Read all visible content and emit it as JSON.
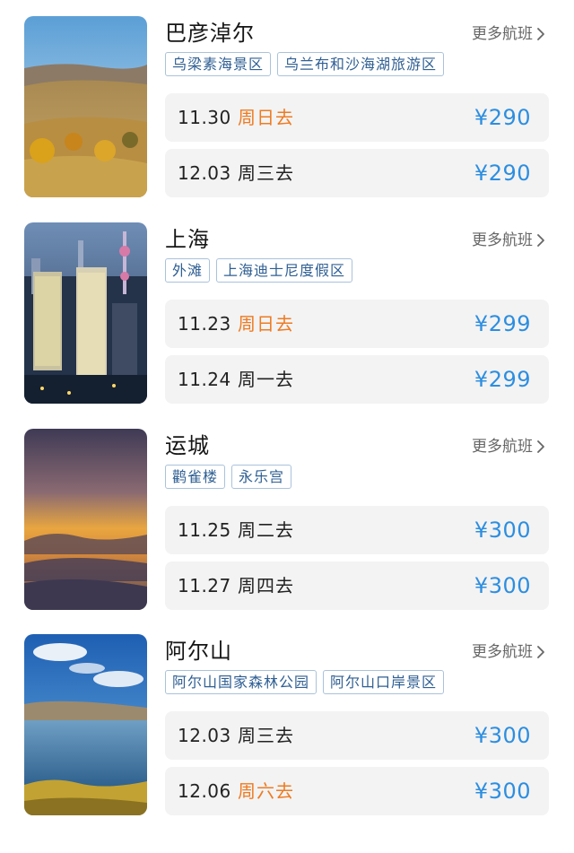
{
  "more_label": "更多航班",
  "weekend_color": "#ee7b22",
  "price_color": "#2d8ee0",
  "destinations": [
    {
      "city": "巴彦淖尔",
      "tags": [
        "乌梁素海景区",
        "乌兰布和沙海湖旅游区"
      ],
      "flights": [
        {
          "date": "11.30",
          "day": "周日去",
          "price": "¥290",
          "weekend": true
        },
        {
          "date": "12.03",
          "day": "周三去",
          "price": "¥290",
          "weekend": false
        }
      ]
    },
    {
      "city": "上海",
      "tags": [
        "外滩",
        "上海迪士尼度假区"
      ],
      "flights": [
        {
          "date": "11.23",
          "day": "周日去",
          "price": "¥299",
          "weekend": true
        },
        {
          "date": "11.24",
          "day": "周一去",
          "price": "¥299",
          "weekend": false
        }
      ]
    },
    {
      "city": "运城",
      "tags": [
        "鹳雀楼",
        "永乐宫"
      ],
      "flights": [
        {
          "date": "11.25",
          "day": "周二去",
          "price": "¥300",
          "weekend": false
        },
        {
          "date": "11.27",
          "day": "周四去",
          "price": "¥300",
          "weekend": false
        }
      ]
    },
    {
      "city": "阿尔山",
      "tags": [
        "阿尔山国家森林公园",
        "阿尔山口岸景区"
      ],
      "flights": [
        {
          "date": "12.03",
          "day": "周三去",
          "price": "¥300",
          "weekend": false
        },
        {
          "date": "12.06",
          "day": "周六去",
          "price": "¥300",
          "weekend": true
        }
      ]
    }
  ]
}
